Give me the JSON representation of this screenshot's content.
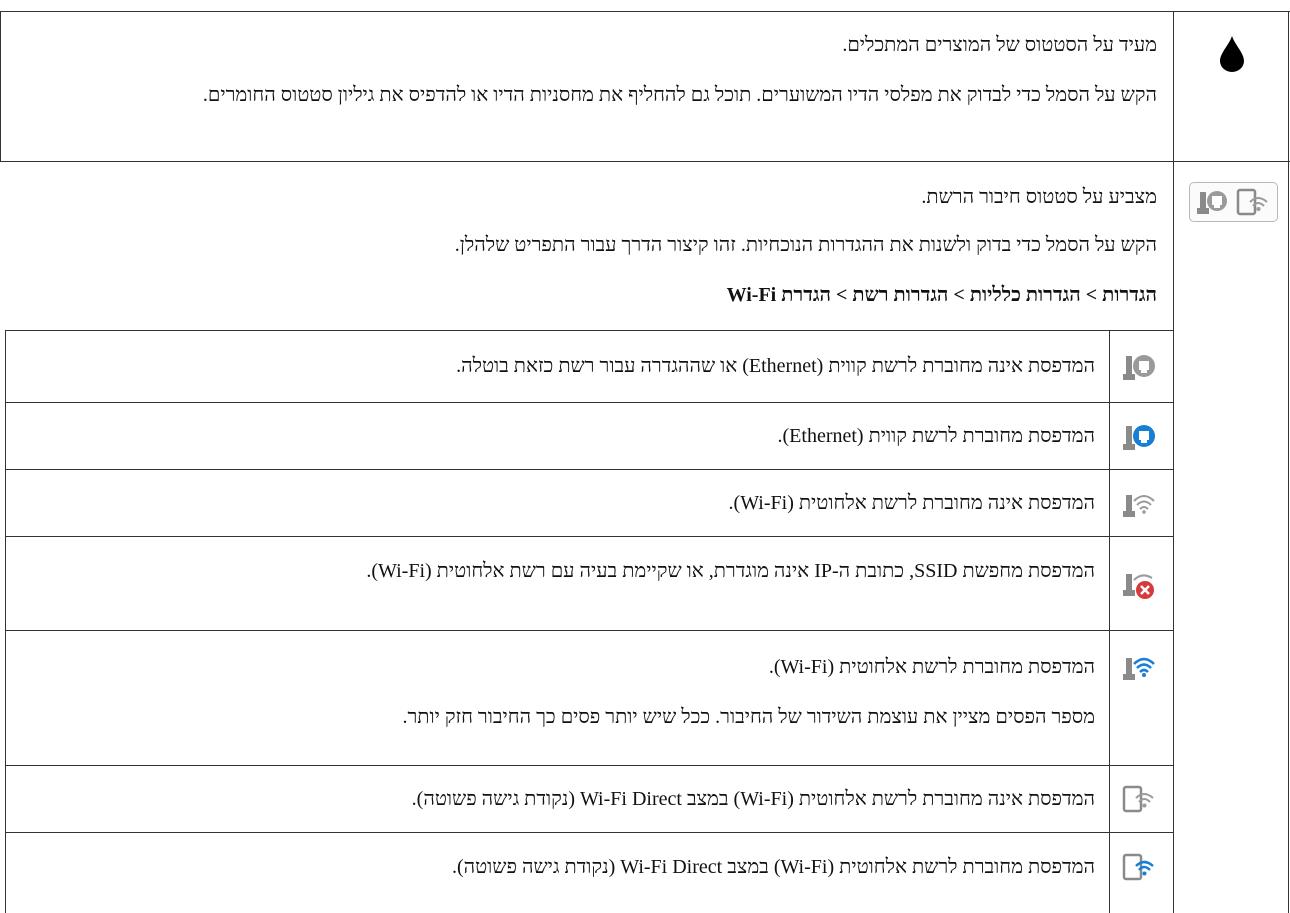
{
  "ink_section": {
    "icon": "ink-drop-icon",
    "line1": "מעיד על הסטטוס של המוצרים המתכלים.",
    "line2": "הקש על הסמל כדי לבדוק את מפלסי הדיו המשוערים. תוכל גם להחליף את מחסניות הדיו או להדפיס את גיליון סטטוס החומרים."
  },
  "network_section": {
    "icons": [
      "ethernet-status-icon",
      "wifi-direct-status-icon"
    ],
    "line1": "מצביע על סטטוס חיבור הרשת.",
    "line2": "הקש על הסמל כדי בדוק ולשנות את ההגדרות הנוכחיות. זהו קיצור הדרך עבור התפריט שלהלן.",
    "menu_path": "הגדרות > הגדרות כלליות > הגדרות רשת > הגדרת Wi-Fi",
    "rows": [
      {
        "icon": "ethernet-disconnected-icon",
        "text": "המדפסת אינה מחוברת לרשת קווית (Ethernet) או שההגדרה עבור רשת כזאת בוטלה."
      },
      {
        "icon": "ethernet-connected-icon",
        "text": "המדפסת מחוברת לרשת קווית (Ethernet)."
      },
      {
        "icon": "wifi-disconnected-icon",
        "text": "המדפסת אינה מחוברת לרשת אלחוטית (Wi-Fi)."
      },
      {
        "icon": "wifi-error-icon",
        "text": "המדפסת מחפשת SSID, כתובת ה-IP אינה מוגדרת, או שקיימת בעיה עם רשת אלחוטית (Wi-Fi)."
      },
      {
        "icon": "wifi-connected-icon",
        "text": "המדפסת מחוברת לרשת אלחוטית (Wi-Fi).",
        "note": "מספר הפסים מציין את עוצמת השידור של החיבור. ככל שיש יותר פסים כך החיבור חזק יותר."
      },
      {
        "icon": "wifi-direct-disconnected-icon",
        "text": "המדפסת אינה מחוברת לרשת אלחוטית (Wi-Fi) במצב Wi-Fi Direct (נקודת גישה פשוטה)."
      },
      {
        "icon": "wifi-direct-connected-icon",
        "text": "המדפסת מחוברת לרשת אלחוטית (Wi-Fi) במצב Wi-Fi Direct (נקודת גישה פשוטה)."
      }
    ]
  },
  "colors": {
    "icon_gray": "#8a8a8a",
    "icon_blue": "#1a7fd4",
    "error_red": "#d63a3a",
    "line": "#333333"
  }
}
